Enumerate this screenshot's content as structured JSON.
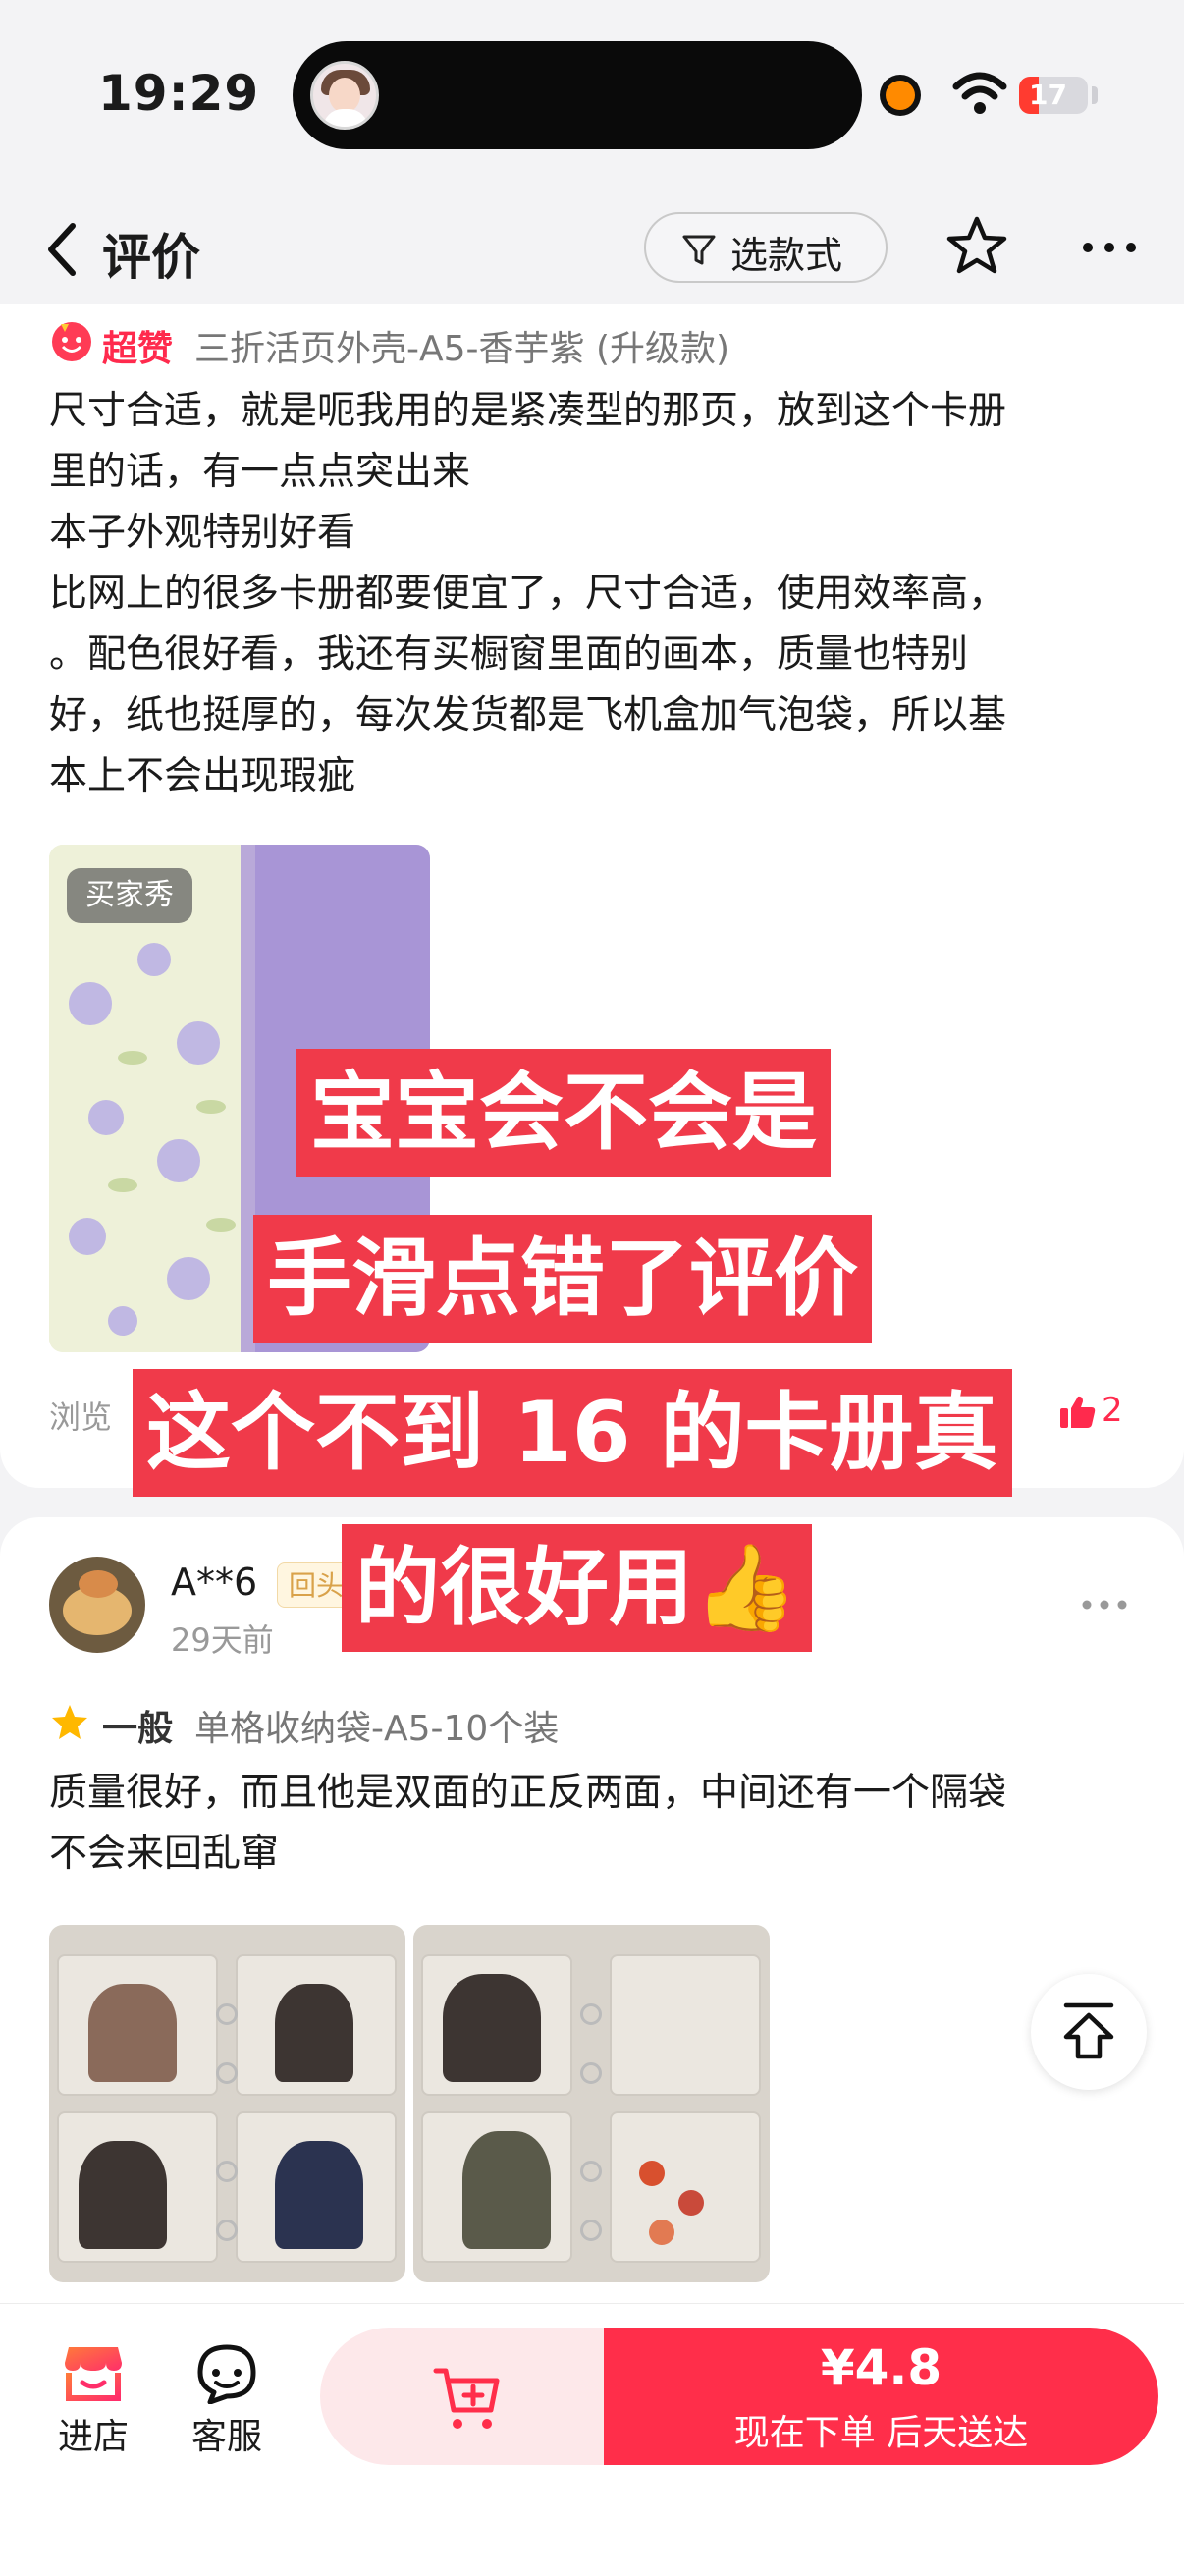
{
  "status_bar": {
    "time": "19:29",
    "battery": "17"
  },
  "nav": {
    "title": "评价",
    "filter_label": "选款式"
  },
  "review1": {
    "badge": "超赞",
    "variant": "三折活页外壳-A5-香芋紫 (升级款)",
    "lines": [
      "尺寸合适，就是呃我用的是紧凑型的那页，放到这个卡册",
      "里的话，有一点点突出来",
      "本子外观特别好看",
      "比网上的很多卡册都要便宜了，尺寸合适，使用效率高，",
      "。配色很好看，我还有买橱窗里面的画本，质量也特别",
      "好，纸也挺厚的，每次发货都是飞机盒加气泡袋，所以基",
      "本上不会出现瑕疵"
    ],
    "photo_tag": "买家秀",
    "views": "浏览",
    "likes": "2"
  },
  "review2": {
    "user": "A**6",
    "tag": "回头",
    "time": "29天前",
    "badge": "一般",
    "variant": "单格收纳袋-A5-10个装",
    "lines": [
      "质量很好，而且他是双面的正反两面，中间还有一个隔袋",
      "不会来回乱窜"
    ]
  },
  "overlay": {
    "lines": [
      "宝宝会不会是",
      "手滑点错了评价",
      "这个不到 16 的卡册真",
      "的很好用👍"
    ]
  },
  "bottom_bar": {
    "shop_label": "进店",
    "service_label": "客服",
    "price": "¥4.8",
    "buy_sub": "现在下单  后天送达"
  },
  "colors": {
    "accent": "#ff2e4a",
    "overlay_bg": "#f03a4a",
    "badge_red": "#ff2a4d"
  },
  "icons": [
    "back-arrow-icon",
    "filter-icon",
    "star-outline-icon",
    "more-dots-icon",
    "smiley-face-icon",
    "thumb-up-icon",
    "star-filled-icon",
    "back-to-top-icon",
    "shop-icon",
    "customer-service-icon",
    "add-cart-icon"
  ]
}
